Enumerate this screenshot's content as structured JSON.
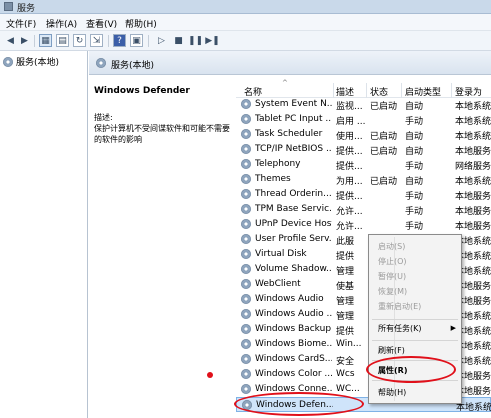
{
  "window": {
    "title": "服务"
  },
  "menu": [
    "文件(F)",
    "操作(A)",
    "查看(V)",
    "帮助(H)"
  ],
  "tree": {
    "root": "服务(本地)"
  },
  "header": {
    "title": "服务(本地)"
  },
  "details": {
    "service_name": "Windows Defender",
    "desc_label": "描述:",
    "desc_text": "保护计算机不受间谍软件和可能不需要的软件的影响"
  },
  "columns": [
    "名称",
    "描述",
    "状态",
    "启动类型",
    "登录为"
  ],
  "rows": [
    {
      "name": "System Event N...",
      "desc": "监视...",
      "status": "已启动",
      "startup": "自动",
      "logon": "本地系统"
    },
    {
      "name": "Tablet PC Input ...",
      "desc": "启用 ...",
      "status": "",
      "startup": "手动",
      "logon": "本地系统"
    },
    {
      "name": "Task Scheduler",
      "desc": "使用...",
      "status": "已启动",
      "startup": "自动",
      "logon": "本地系统"
    },
    {
      "name": "TCP/IP NetBIOS ...",
      "desc": "提供...",
      "status": "已启动",
      "startup": "自动",
      "logon": "本地服务"
    },
    {
      "name": "Telephony",
      "desc": "提供...",
      "status": "",
      "startup": "手动",
      "logon": "网络服务"
    },
    {
      "name": "Themes",
      "desc": "为用...",
      "status": "已启动",
      "startup": "自动",
      "logon": "本地系统"
    },
    {
      "name": "Thread Orderin...",
      "desc": "提供...",
      "status": "",
      "startup": "手动",
      "logon": "本地服务"
    },
    {
      "name": "TPM Base Servic...",
      "desc": "允许...",
      "status": "",
      "startup": "手动",
      "logon": "本地服务"
    },
    {
      "name": "UPnP Device Host",
      "desc": "允许...",
      "status": "",
      "startup": "手动",
      "logon": "本地服务"
    },
    {
      "name": "User Profile Serv...",
      "desc": "此服",
      "status": "",
      "startup": "",
      "logon": "本地系统"
    },
    {
      "name": "Virtual Disk",
      "desc": "提供",
      "status": "",
      "startup": "",
      "logon": "本地系统"
    },
    {
      "name": "Volume Shadow...",
      "desc": "管理",
      "status": "",
      "startup": "",
      "logon": "本地系统"
    },
    {
      "name": "WebClient",
      "desc": "使基",
      "status": "",
      "startup": "",
      "logon": "本地服务"
    },
    {
      "name": "Windows Audio",
      "desc": "管理",
      "status": "",
      "startup": "",
      "logon": "本地服务"
    },
    {
      "name": "Windows Audio ...",
      "desc": "管理",
      "status": "",
      "startup": "",
      "logon": "本地系统"
    },
    {
      "name": "Windows Backup",
      "desc": "提供",
      "status": "",
      "startup": "",
      "logon": "本地系统"
    },
    {
      "name": "Windows Biome...",
      "desc": "Win...",
      "status": "",
      "startup": "",
      "logon": "本地系统"
    },
    {
      "name": "Windows CardS...",
      "desc": "安全",
      "status": "",
      "startup": "",
      "logon": "本地系统"
    },
    {
      "name": "Windows Color ...",
      "desc": "Wcs",
      "status": "",
      "startup": "",
      "logon": "本地服务"
    },
    {
      "name": "Windows Conne...",
      "desc": "WC...",
      "status": "",
      "startup": "",
      "logon": "本地服务"
    },
    {
      "name": "Windows Defen...",
      "desc": "",
      "status": "",
      "startup": "",
      "logon": "本地系统"
    }
  ],
  "context_menu": {
    "start": "启动(S)",
    "stop": "停止(O)",
    "pause": "暂停(U)",
    "resume": "恢复(M)",
    "restart": "重新启动(E)",
    "all_tasks": "所有任务(K)",
    "refresh": "刷新(F)",
    "properties": "属性(R)",
    "help": "帮助(H)"
  },
  "colors": {
    "annotation": "#e0101a",
    "selection": "#cfe4fa"
  }
}
